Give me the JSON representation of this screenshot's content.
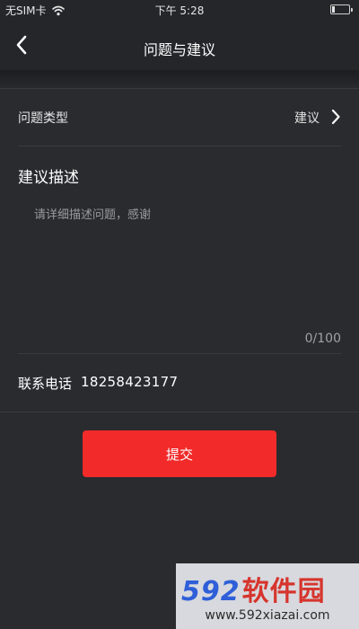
{
  "status_bar": {
    "carrier": "无SIM卡",
    "time": "下午 5:28",
    "battery_level": 0.15
  },
  "nav": {
    "title": "问题与建议",
    "back_icon": "chevron-left-icon"
  },
  "form": {
    "type_label": "问题类型",
    "type_value": "建议",
    "description_title": "建议描述",
    "description_placeholder": "请详细描述问题，感谢",
    "description_value": "",
    "char_count": "0/100",
    "phone_label": "联系电话",
    "phone_value": "18258423177",
    "submit_label": "提交"
  },
  "watermark": {
    "logo_digits": "592",
    "logo_text": "软件园",
    "url": "www.592xiazai.com"
  },
  "colors": {
    "background": "#2a2b2f",
    "nav_background": "#25262a",
    "accent_button": "#f22a2a",
    "watermark_blue": "#2f5fd8",
    "watermark_red": "#d6352d"
  }
}
